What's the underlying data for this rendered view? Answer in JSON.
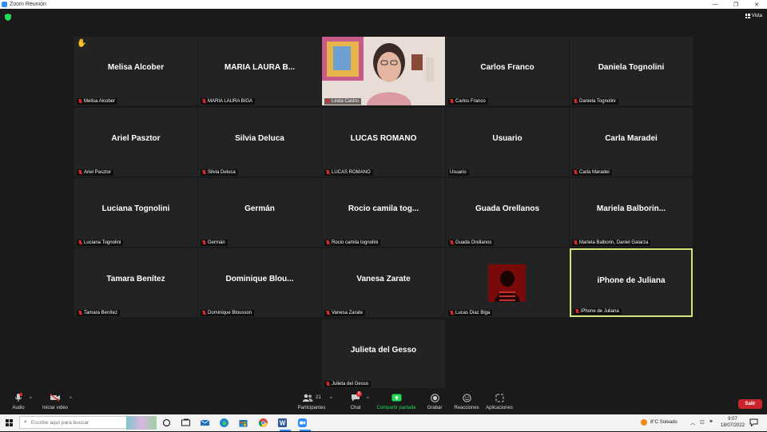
{
  "window": {
    "title": "Zoom Reunión"
  },
  "header": {
    "view_label": "Vista"
  },
  "tiles": [
    {
      "name": "Melisa Alcober",
      "label": "Melisa Alcober",
      "hand": true
    },
    {
      "name": "MARIA  LAURA  B...",
      "label": "MARIA LAURA BIGA"
    },
    {
      "name": "",
      "label": "Linda Castro",
      "video": true
    },
    {
      "name": "Carlos Franco",
      "label": "Carlos Franco"
    },
    {
      "name": "Daniela Tognolini",
      "label": "Daniela Tognolini"
    },
    {
      "name": "Ariel Pasztor",
      "label": "Ariel Pasztor"
    },
    {
      "name": "Silvia Deluca",
      "label": "Silvia Deluca"
    },
    {
      "name": "LUCAS ROMANO",
      "label": "LUCAS ROMANO"
    },
    {
      "name": "Usuario",
      "label": "Usuario",
      "no_mute": true
    },
    {
      "name": "Carla Maradei",
      "label": "Carla Maradei"
    },
    {
      "name": "Luciana Tognolini",
      "label": "Luciana Tognolini"
    },
    {
      "name": "Germán",
      "label": "Germán"
    },
    {
      "name": "Rocio camila tog...",
      "label": "Rocio camila tognolini"
    },
    {
      "name": "Guada Orellanos",
      "label": "Guada Orellanos"
    },
    {
      "name": "Mariela  Balborin...",
      "label": "Mariela Balborin, Daniel Galarza"
    },
    {
      "name": "Tamara Benítez",
      "label": "Tamara Benítez"
    },
    {
      "name": "Dominique  Blou...",
      "label": "Dominique Blousson"
    },
    {
      "name": "Vanesa Zarate",
      "label": "Vanesa Zarate"
    },
    {
      "name": "",
      "label": "Lucas Diaz Biga",
      "photo": true
    },
    {
      "name": "iPhone de Juliana",
      "label": "iPhone de Juliana",
      "active": true
    },
    {
      "name": "Julieta del Gesso",
      "label": "Julieta del Gesso"
    }
  ],
  "toolbar": {
    "audio": "Audio",
    "video": "Iniciar video",
    "participants": "Participantes",
    "participants_count": "21",
    "chat": "Chat",
    "chat_badge": "8",
    "share": "Compartir pantalla",
    "record": "Grabar",
    "reactions": "Reacciones",
    "apps": "Aplicaciones",
    "leave": "Salir",
    "share_color": "#23d959",
    "leave_color": "#c8262c"
  },
  "taskbar": {
    "search_placeholder": "Escribe aquí para buscar",
    "weather": "8°C  Soleado",
    "time": "9:07",
    "date": "18/07/2022",
    "icons": [
      "task-view-icon",
      "file-explorer-icon",
      "mail-icon",
      "edge-icon",
      "store-icon",
      "chrome-icon",
      "word-icon",
      "zoom-icon"
    ]
  }
}
